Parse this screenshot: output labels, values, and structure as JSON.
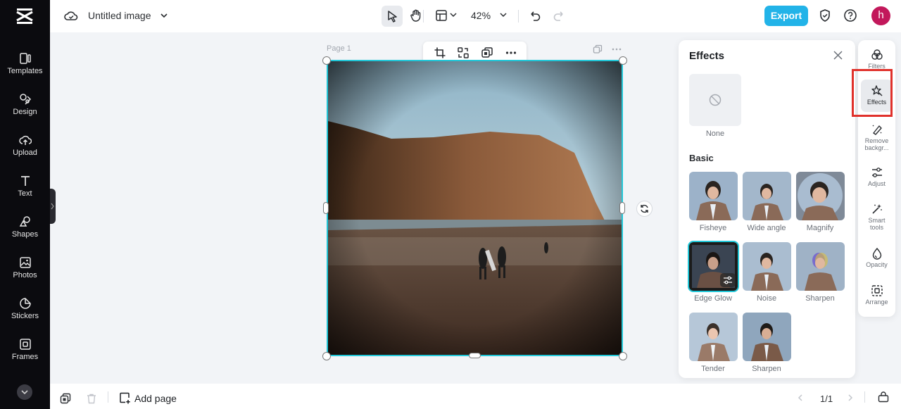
{
  "app": {
    "document_title": "Untitled image",
    "export_label": "Export",
    "avatar_initial": "h",
    "zoom_level": "42%",
    "accent_color": "#22b3e8"
  },
  "sidebar": {
    "items": [
      {
        "label": "Templates",
        "icon": "templates-icon"
      },
      {
        "label": "Design",
        "icon": "design-icon"
      },
      {
        "label": "Upload",
        "icon": "upload-icon"
      },
      {
        "label": "Text",
        "icon": "text-icon"
      },
      {
        "label": "Shapes",
        "icon": "shapes-icon"
      },
      {
        "label": "Photos",
        "icon": "photos-icon"
      },
      {
        "label": "Stickers",
        "icon": "stickers-icon"
      },
      {
        "label": "Frames",
        "icon": "frames-icon"
      }
    ]
  },
  "canvas": {
    "page_label": "Page 1"
  },
  "effects_panel": {
    "title": "Effects",
    "none_label": "None",
    "section_title": "Basic",
    "effects": [
      {
        "label": "Fisheye",
        "selected": false
      },
      {
        "label": "Wide angle",
        "selected": false
      },
      {
        "label": "Magnify",
        "selected": false
      },
      {
        "label": "Edge Glow",
        "selected": true
      },
      {
        "label": "Noise",
        "selected": false
      },
      {
        "label": "Sharpen",
        "selected": false
      },
      {
        "label": "Tender",
        "selected": false
      },
      {
        "label": "Sharpen",
        "selected": false
      }
    ]
  },
  "right_rail": {
    "items": [
      {
        "label": "Filters",
        "icon": "filters-icon"
      },
      {
        "label": "Effects",
        "icon": "effects-icon",
        "active": true
      },
      {
        "label": "Remove backgr...",
        "icon": "remove-background-icon"
      },
      {
        "label": "Adjust",
        "icon": "adjust-icon"
      },
      {
        "label": "Smart tools",
        "icon": "smart-tools-icon"
      },
      {
        "label": "Opacity",
        "icon": "opacity-icon"
      },
      {
        "label": "Arrange",
        "icon": "arrange-icon"
      }
    ]
  },
  "bottom_bar": {
    "add_page_label": "Add page",
    "page_counter": "1/1"
  }
}
